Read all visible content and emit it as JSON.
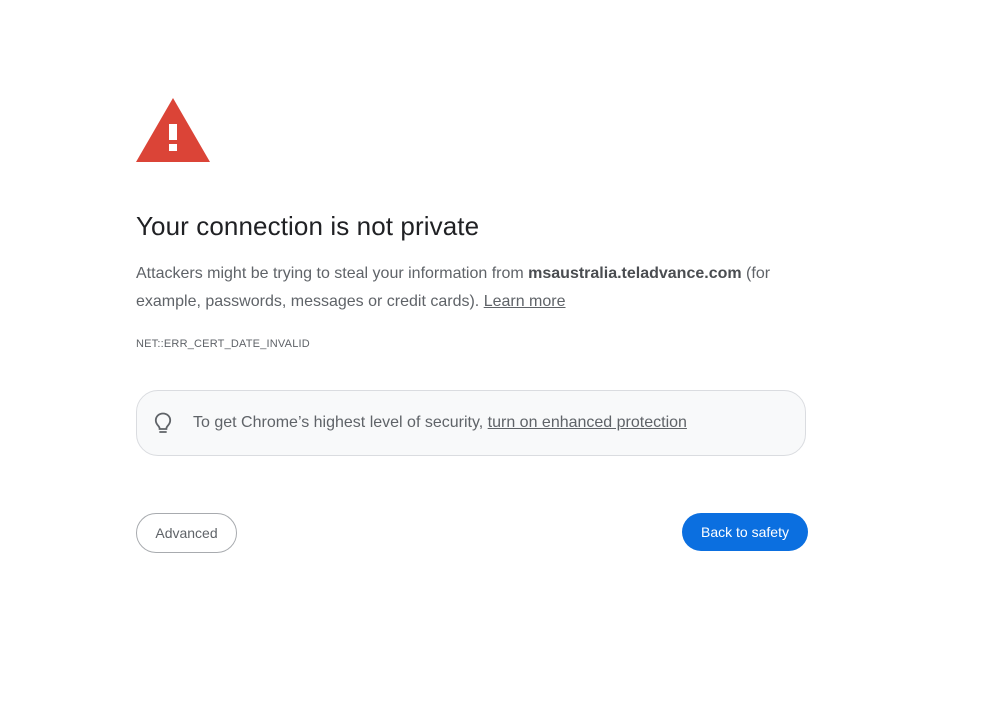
{
  "warning": {
    "icon": "warning-triangle-icon",
    "color": "#db4437"
  },
  "title": "Your connection is not private",
  "explanation": {
    "before": "Attackers might be trying to steal your information from ",
    "domain": "msaustralia.teladvance.com",
    "after": " (for example, passwords, messages or credit cards). ",
    "learn_more": "Learn more"
  },
  "error_code": "NET::ERR_CERT_DATE_INVALID",
  "enhanced_protection": {
    "icon": "lightbulb-icon",
    "text": "To get Chrome’s highest level of security, ",
    "link": "turn on enhanced protection"
  },
  "buttons": {
    "advanced": "Advanced",
    "back_to_safety": "Back to safety",
    "primary_color": "#0b6fe0"
  }
}
